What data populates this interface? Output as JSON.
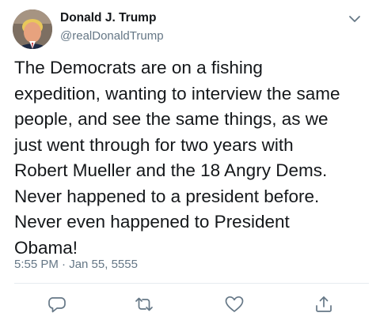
{
  "tweet": {
    "author_name": "Donald J. Trump",
    "author_handle": "@realDonaldTrump",
    "text": "The Democrats are on a fishing\nexpedition, wanting to interview the same\npeople, and see the same things, as we\njust went through for two years with\nRobert Mueller and the 18 Angry Dems.\nNever happened to a president before.\nNever even happened to President\nObama!",
    "timestamp": "5:55 PM · Jan 55, 5555"
  },
  "icons": {
    "menu": "chevron-down-icon",
    "reply": "reply-icon",
    "retweet": "retweet-icon",
    "like": "heart-icon",
    "share": "share-icon"
  },
  "colors": {
    "text": "#14171a",
    "secondary": "#657786",
    "divider": "#e6ecf0"
  }
}
